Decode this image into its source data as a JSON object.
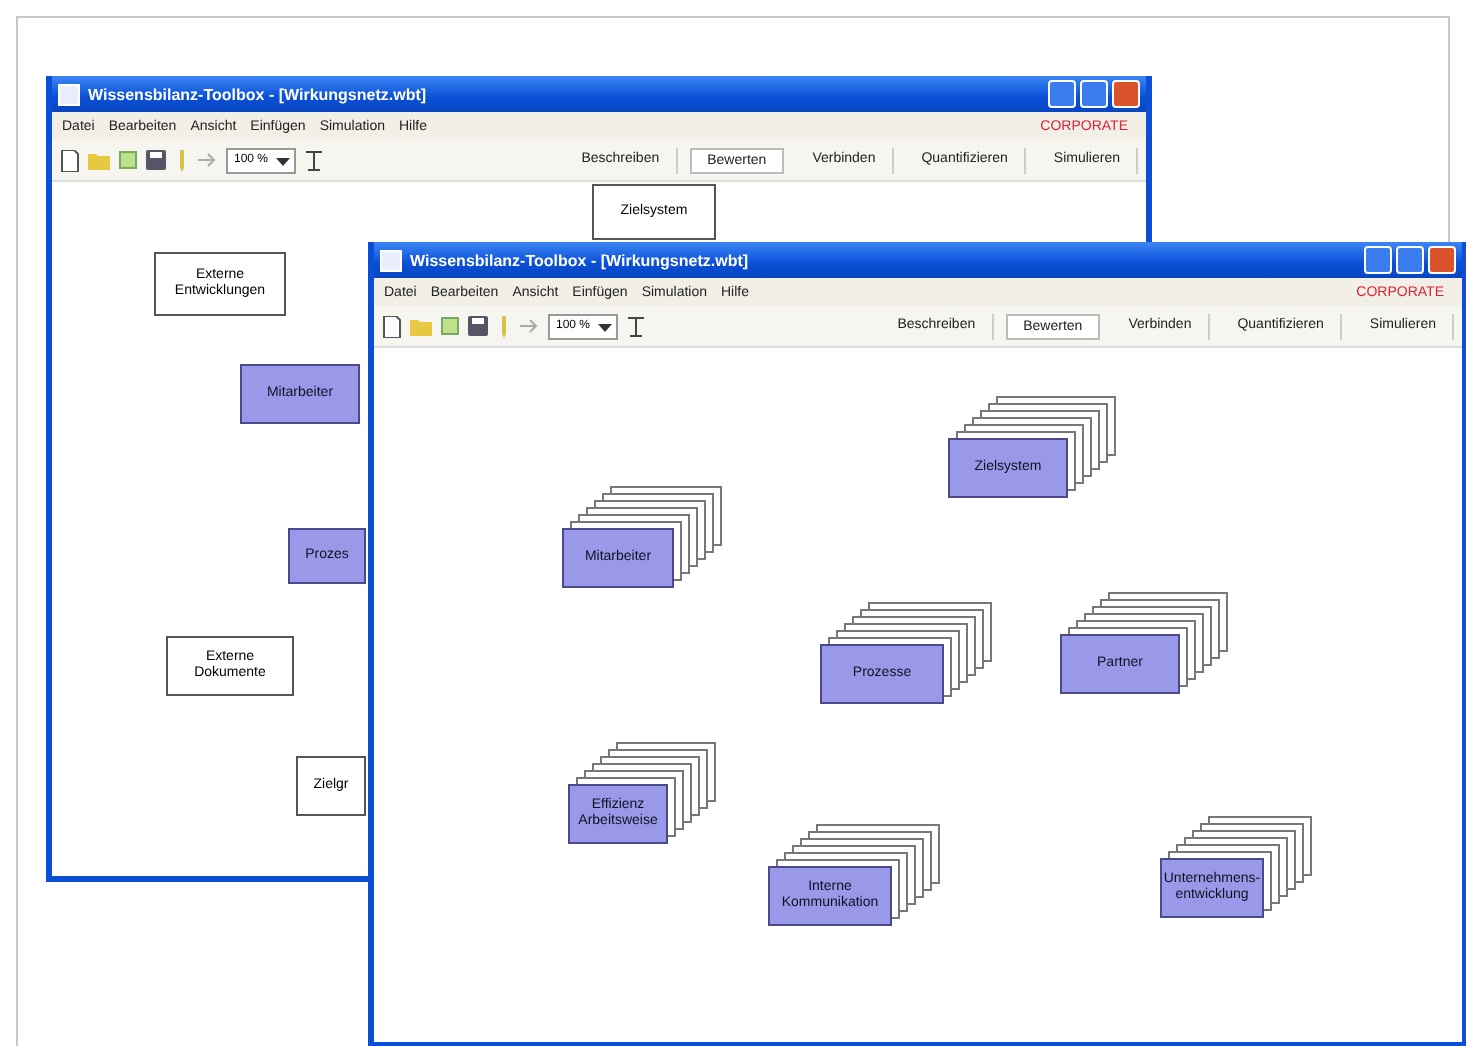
{
  "windows": [
    {
      "title": "Wissensbilanz-Toolbox - [Wirkungsnetz.wbt]",
      "menu": [
        "Datei",
        "Bearbeiten",
        "Ansicht",
        "Einfügen",
        "Simulation",
        "Hilfe"
      ],
      "brand": "CORPORATE",
      "zoom": "100 %",
      "tabs": [
        {
          "label": "Beschreiben",
          "selected": false
        },
        {
          "label": "Bewerten",
          "selected": true
        },
        {
          "label": "Verbinden",
          "selected": false
        },
        {
          "label": "Quantifizieren",
          "selected": false
        },
        {
          "label": "Simulieren",
          "selected": false
        }
      ],
      "nodes": [
        {
          "label": "Zielsystem",
          "kind": "plain"
        },
        {
          "label": "Externe Entwicklungen",
          "kind": "plain"
        },
        {
          "label": "Mitarbeiter",
          "kind": "factor"
        },
        {
          "label": "Prozes",
          "kind": "factor"
        },
        {
          "label": "Externe Dokumente",
          "kind": "plain"
        },
        {
          "label": "Zielgr",
          "kind": "plain"
        }
      ]
    },
    {
      "title": "Wissensbilanz-Toolbox - [Wirkungsnetz.wbt]",
      "menu": [
        "Datei",
        "Bearbeiten",
        "Ansicht",
        "Einfügen",
        "Simulation",
        "Hilfe"
      ],
      "brand": "CORPORATE",
      "zoom": "100 %",
      "tabs": [
        {
          "label": "Beschreiben",
          "selected": false
        },
        {
          "label": "Bewerten",
          "selected": true
        },
        {
          "label": "Verbinden",
          "selected": false
        },
        {
          "label": "Quantifizieren",
          "selected": false
        },
        {
          "label": "Simulieren",
          "selected": false
        }
      ],
      "nodes": [
        {
          "label": "Zielsystem",
          "kind": "stack"
        },
        {
          "label": "Mitarbeiter",
          "kind": "stack"
        },
        {
          "label": "Prozesse",
          "kind": "stack"
        },
        {
          "label": "Partner",
          "kind": "stack"
        },
        {
          "label": "Effizienz Arbeitsweise",
          "kind": "stack"
        },
        {
          "label": "Interne Kommunikation",
          "kind": "stack"
        },
        {
          "label": "Unternehmens-entwicklung",
          "kind": "stack"
        }
      ]
    }
  ]
}
